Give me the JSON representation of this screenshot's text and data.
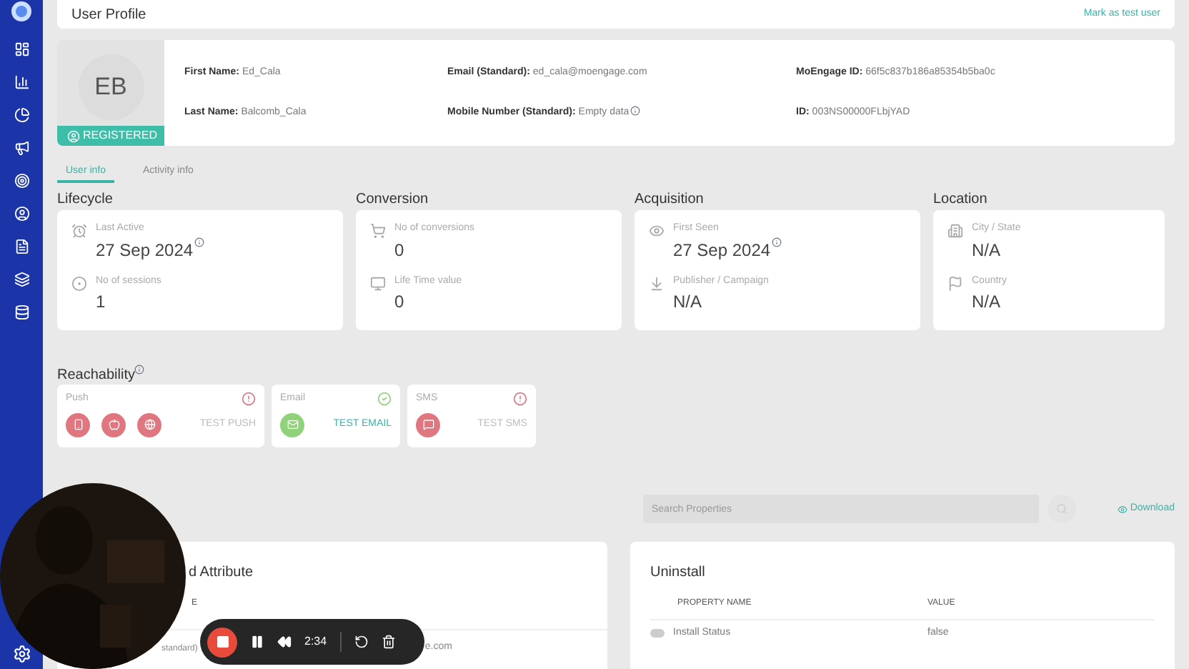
{
  "header": {
    "title": "User Profile",
    "link": "Mark as test user"
  },
  "profile": {
    "initials": "EB",
    "badge": "REGISTERED",
    "fields": [
      {
        "label": "First Name:",
        "value": "Ed_Cala",
        "info": false
      },
      {
        "label": "Email (Standard):",
        "value": "ed_cala@moengage.com",
        "info": false
      },
      {
        "label": "MoEngage ID:",
        "value": "66f5c837b186a85354b5ba0c",
        "info": false
      },
      {
        "label": "Last Name:",
        "value": "Balcomb_Cala",
        "info": false
      },
      {
        "label": "Mobile Number (Standard):",
        "value": "Empty data",
        "info": true
      },
      {
        "label": "ID:",
        "value": "003NS00000FLbjYAD",
        "info": false
      }
    ]
  },
  "tabs": [
    {
      "label": "User info",
      "selected": true
    },
    {
      "label": "Activity info",
      "selected": false
    }
  ],
  "sections": [
    {
      "title": "Lifecycle",
      "items": [
        {
          "label": "Last Active",
          "value": "27 Sep 2024",
          "info": true
        },
        {
          "label": "No of sessions",
          "value": "1",
          "info": false
        }
      ]
    },
    {
      "title": "Conversion",
      "items": [
        {
          "label": "No of conversions",
          "value": "0",
          "info": false
        },
        {
          "label": "Life Time value",
          "value": "0",
          "info": false
        }
      ]
    },
    {
      "title": "Acquisition",
      "items": [
        {
          "label": "First Seen",
          "value": "27 Sep 2024",
          "info": true
        },
        {
          "label": "Publisher / Campaign",
          "value": "N/A",
          "info": false
        }
      ]
    },
    {
      "title": "Location",
      "items": [
        {
          "label": "City / State",
          "value": "N/A",
          "info": false
        },
        {
          "label": "Country",
          "value": "N/A",
          "info": false
        }
      ]
    }
  ],
  "reachability": {
    "title": "Reachability",
    "channels": [
      {
        "name": "Push",
        "reachable": false,
        "action": "TEST PUSH"
      },
      {
        "name": "Email",
        "reachable": true,
        "action": "TEST EMAIL"
      },
      {
        "name": "SMS",
        "reachable": false,
        "action": "TEST SMS"
      }
    ]
  },
  "search": {
    "placeholder": "Search Properties"
  },
  "download": "Download",
  "attribute_card": {
    "title": "d Attribute",
    "column_1": "E",
    "cells": [
      "standard)",
      "e.com"
    ]
  },
  "uninstall": {
    "title": "Uninstall",
    "columns": [
      "PROPERTY NAME",
      "VALUE"
    ],
    "rows": [
      {
        "name": "Install Status",
        "value": "false"
      }
    ]
  },
  "recorder": {
    "time": "2:34"
  }
}
